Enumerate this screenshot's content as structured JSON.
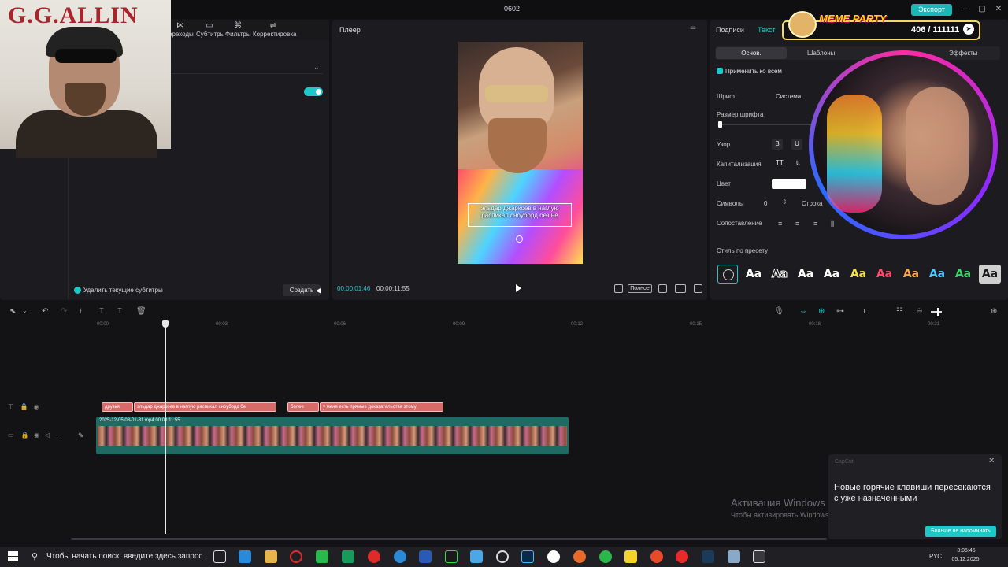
{
  "window": {
    "title": "0602",
    "export_label": "Экспорт"
  },
  "left_toolbar": {
    "items": [
      {
        "label": "ереходы",
        "icon": "transitions-icon"
      },
      {
        "label": "Субтитры",
        "icon": "subtitles-icon"
      },
      {
        "label": "Фильтры",
        "icon": "filters-icon"
      },
      {
        "label": "Корректировка",
        "icon": "adjust-icon"
      }
    ]
  },
  "left_panel": {
    "delete_current_label": "Удалить текущие субтитры",
    "create_label": "Создать",
    "toggle_on": true
  },
  "overlay_gg": {
    "title": "G.G.ALLIN"
  },
  "player": {
    "title": "Плеер",
    "caption": "эльдар джаркоев в наглую распикал сноуборд без не",
    "time_current": "00:00:01:46",
    "time_total": "00:00:11:55",
    "full_label": "Полное"
  },
  "right_panel": {
    "tabs": [
      "Подписи",
      "Текст"
    ],
    "subtabs": [
      "Основ.",
      "Шаблоны",
      "Эффекты"
    ],
    "apply_all_label": "Применить ко всем",
    "font_label": "Шрифт",
    "font_value": "Система",
    "font_size_label": "Размер шрифта",
    "pattern_label": "Узор",
    "pattern_bold": "B",
    "pattern_underline": "U",
    "caps_label": "Капитализация",
    "caps_upper": "TT",
    "caps_lower": "tt",
    "color_label": "Цвет",
    "color_value": "#ffffff",
    "symbols_label": "Символы",
    "symbols_value": "0",
    "row_label": "Строка",
    "align_label": "Сопоставление",
    "preset_label": "Стиль по пресету",
    "presets": [
      {
        "label": "Aa",
        "color": "#ffffff",
        "bg": "transparent"
      },
      {
        "label": "Aa",
        "color": "#111111",
        "bg": "transparent",
        "stroke": "#ffffff"
      },
      {
        "label": "Aa",
        "color": "#ffffff",
        "bg": "transparent"
      },
      {
        "label": "Aa",
        "color": "#ffffff",
        "bg": "transparent"
      },
      {
        "label": "Aa",
        "color": "#f4e14a",
        "bg": "transparent"
      },
      {
        "label": "Aa",
        "color": "#ff4a6a",
        "bg": "transparent"
      },
      {
        "label": "Aa",
        "color": "#ffa84a",
        "bg": "transparent"
      },
      {
        "label": "Aa",
        "color": "#4ac8ff",
        "bg": "transparent"
      },
      {
        "label": "Aa",
        "color": "#3ad46a",
        "bg": "transparent"
      },
      {
        "label": "Aa",
        "color": "#1a1a1a",
        "bg": "#cfcfcf"
      }
    ]
  },
  "meme_overlay": {
    "title": "MEME PARTY",
    "count": "406 / 111111"
  },
  "timeline": {
    "ticks": [
      "00:00",
      "00:03",
      "00:06",
      "00:09",
      "00:12",
      "00:15",
      "00:18",
      "00:21"
    ],
    "subtitle_clips": [
      "друзья",
      "эльдар джаркоев в наглую распикал сноуборд бе",
      "более",
      "у меня есть прямые доказательства этому"
    ],
    "video_clip_label": "2025-12-05 08-01-31.mp4   00:00:11:55"
  },
  "toast": {
    "app": "CapCut",
    "text": "Новые горячие клавиши пересекаются с уже назначенными",
    "button": "Больше не напоминать"
  },
  "watermark": {
    "title": "Активация Windows",
    "subtitle": "Чтобы активировать Windows, перейдите в раздел \"Параметры\"."
  },
  "taskbar": {
    "search_placeholder": "Чтобы начать поиск, введите здесь запрос",
    "lang": "РУС",
    "time": "8:05:45",
    "date": "05.12.2025"
  }
}
